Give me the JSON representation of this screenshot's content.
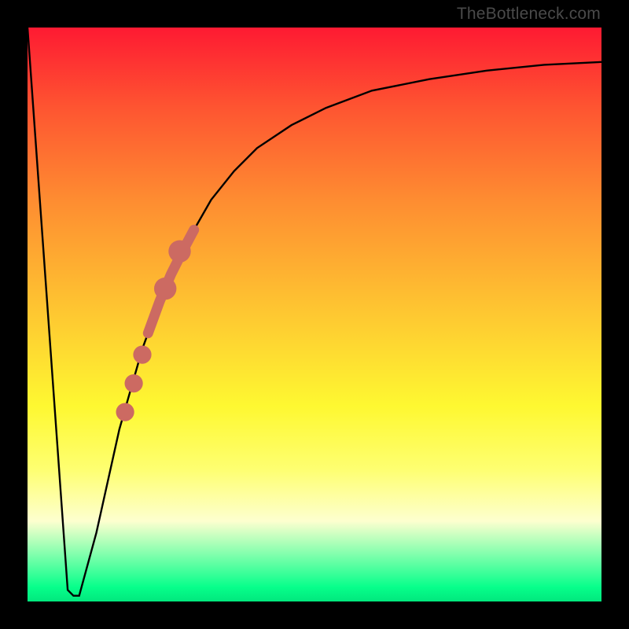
{
  "attribution": "TheBottleneck.com",
  "chart_data": {
    "type": "line",
    "title": "",
    "xlabel": "",
    "ylabel": "",
    "xlim": [
      0,
      100
    ],
    "ylim": [
      0,
      100
    ],
    "series": [
      {
        "name": "bottleneck-curve",
        "x": [
          0,
          7,
          8,
          9,
          12,
          16,
          20,
          24,
          28,
          32,
          36,
          40,
          46,
          52,
          60,
          70,
          80,
          90,
          100
        ],
        "values": [
          100,
          2,
          1,
          1,
          12,
          30,
          44,
          55,
          63,
          70,
          75,
          79,
          83,
          86,
          89,
          91,
          92.5,
          93.5,
          94
        ]
      }
    ],
    "markers": {
      "name": "highlight-dots",
      "color": "#cc6a62",
      "points": [
        {
          "x": 17.0,
          "y": 33.0,
          "r": 1.0
        },
        {
          "x": 18.5,
          "y": 38.0,
          "r": 1.0
        },
        {
          "x": 20.0,
          "y": 43.0,
          "r": 1.0
        },
        {
          "x": 24.0,
          "y": 54.5,
          "r": 1.4
        },
        {
          "x": 26.5,
          "y": 61.0,
          "r": 1.4
        }
      ]
    },
    "gradient_stops": [
      {
        "pos": 0.0,
        "color": "#fe1a32"
      },
      {
        "pos": 0.14,
        "color": "#fe5531"
      },
      {
        "pos": 0.3,
        "color": "#fe8c31"
      },
      {
        "pos": 0.48,
        "color": "#fec231"
      },
      {
        "pos": 0.66,
        "color": "#fef831"
      },
      {
        "pos": 0.77,
        "color": "#feff71"
      },
      {
        "pos": 0.86,
        "color": "#fdffcf"
      },
      {
        "pos": 0.975,
        "color": "#07ff8b"
      },
      {
        "pos": 1.0,
        "color": "#01e77d"
      }
    ]
  }
}
